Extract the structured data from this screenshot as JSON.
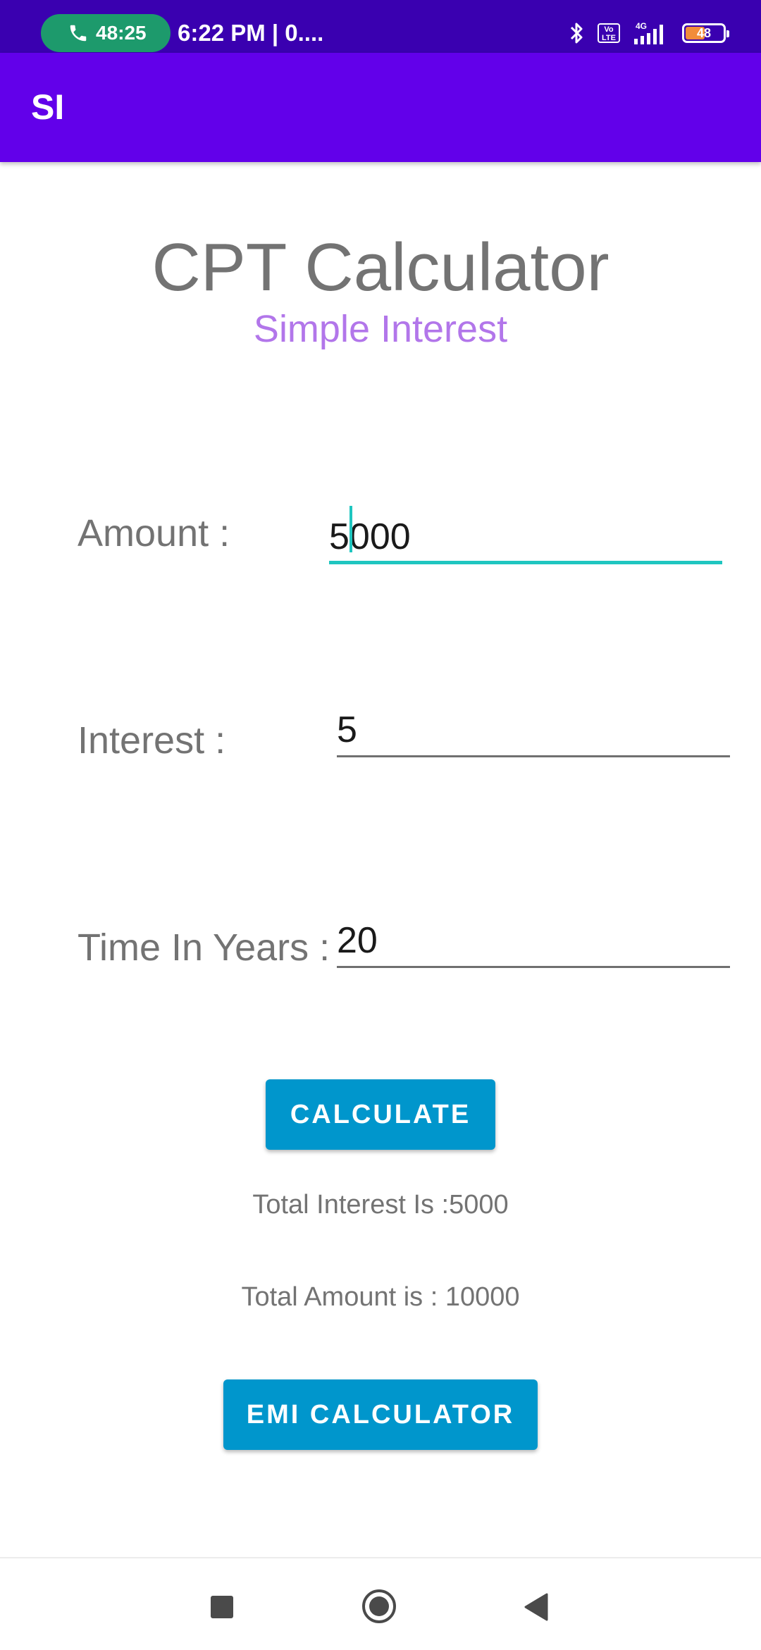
{
  "status_bar": {
    "call_timer": "48:25",
    "time_text": "6:22 PM | 0....",
    "network_badge": "Vo LTE",
    "network_type": "4G",
    "battery_level": "48",
    "icons": [
      "phone-icon",
      "bluetooth-icon",
      "volte-icon",
      "signal-icon",
      "battery-icon"
    ]
  },
  "app_bar": {
    "title": "SI"
  },
  "header": {
    "title": "CPT Calculator",
    "subtitle": "Simple Interest"
  },
  "form": {
    "amount": {
      "label": "Amount :",
      "value": "5000"
    },
    "interest": {
      "label": "Interest :",
      "value": "5"
    },
    "time": {
      "label": "Time In Years :",
      "value": "20"
    }
  },
  "actions": {
    "calculate_label": "CALCULATE",
    "emi_label": "EMI CALCULATOR"
  },
  "results": {
    "total_interest": "Total Interest Is :5000",
    "total_amount": "Total Amount is : 10000"
  },
  "nav_bar": {
    "icons": [
      "recents-icon",
      "home-icon",
      "back-icon"
    ]
  },
  "colors": {
    "status_bar": "#3a00b0",
    "app_bar": "#6200ea",
    "subtitle": "#b276ea",
    "button": "#0096cc",
    "focus": "#1fc6c0",
    "call_pill": "#1d9a6c"
  }
}
